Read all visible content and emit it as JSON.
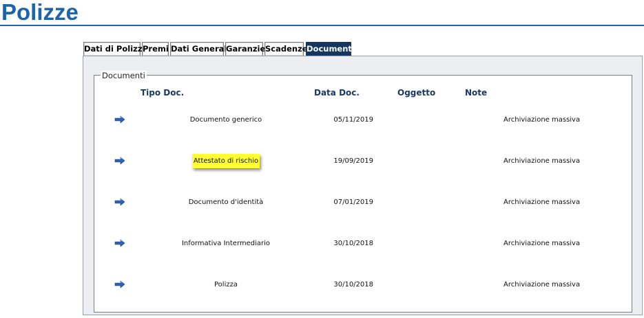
{
  "page": {
    "title": "Polizze"
  },
  "tabs": [
    {
      "label": "Dati di Polizza",
      "active": false
    },
    {
      "label": "Premi",
      "active": false
    },
    {
      "label": "Dati Generali",
      "active": false
    },
    {
      "label": "Garanzie",
      "active": false
    },
    {
      "label": "Scadenze",
      "active": false
    },
    {
      "label": "Documenti",
      "active": true
    }
  ],
  "documents": {
    "legend": "Documenti",
    "columns": [
      "Tipo Doc.",
      "Data Doc.",
      "Oggetto",
      "Note"
    ],
    "rows": [
      {
        "icon": "arrow-right-icon",
        "tipo": "Documento generico",
        "data": "05/11/2019",
        "oggetto": "",
        "note": "Archiviazione massiva",
        "highlighted": false
      },
      {
        "icon": "arrow-right-icon",
        "tipo": "Attestato di rischio",
        "data": "19/09/2019",
        "oggetto": "",
        "note": "Archiviazione massiva",
        "highlighted": true
      },
      {
        "icon": "arrow-right-icon",
        "tipo": "Documento d'identità",
        "data": "07/01/2019",
        "oggetto": "",
        "note": "Archiviazione massiva",
        "highlighted": false
      },
      {
        "icon": "arrow-right-icon",
        "tipo": "Informativa Intermediario",
        "data": "30/10/2018",
        "oggetto": "",
        "note": "Archiviazione massiva",
        "highlighted": false
      },
      {
        "icon": "arrow-right-icon",
        "tipo": "Polizza",
        "data": "30/10/2018",
        "oggetto": "",
        "note": "Archiviazione massiva",
        "highlighted": false
      }
    ]
  },
  "colors": {
    "title": "#1f63a8",
    "active_tab": "#15365f",
    "header_text": "#1b3a62",
    "highlight": "#ffff33",
    "arrow": "#2f62b5"
  }
}
